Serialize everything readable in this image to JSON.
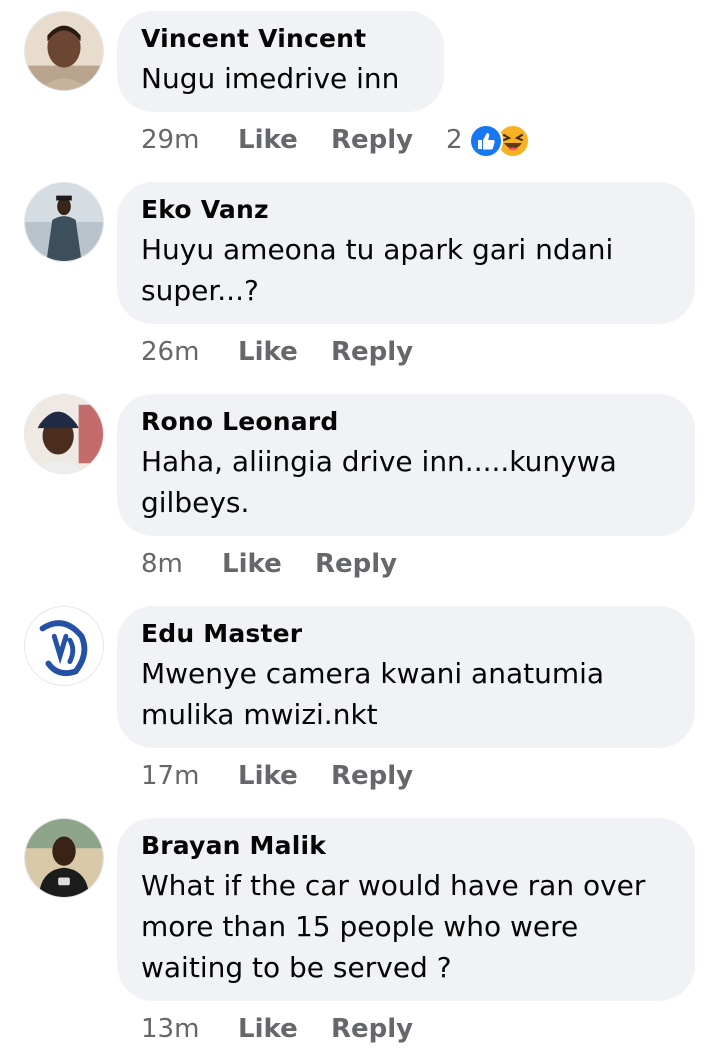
{
  "comments": [
    {
      "author": "Vincent Vincent",
      "lines": [
        "Nugu imedrive inn"
      ],
      "time": "29m",
      "like": "Like",
      "reply": "Reply",
      "reaction_count": "2",
      "reactions": [
        "like-icon",
        "haha-icon"
      ]
    },
    {
      "author": "Eko Vanz",
      "lines": [
        "Huyu ameona tu apark gari ndani",
        "super...?"
      ],
      "time": "26m",
      "like": "Like",
      "reply": "Reply"
    },
    {
      "author": "Rono Leonard",
      "lines": [
        "Haha, aliingia drive inn.....kunywa",
        "gilbeys."
      ],
      "time": "8m",
      "like": "Like",
      "reply": "Reply"
    },
    {
      "author": "Edu Master",
      "lines": [
        "Mwenye camera kwani anatumia",
        "mulika mwizi.nkt"
      ],
      "time": "17m",
      "like": "Like",
      "reply": "Reply"
    },
    {
      "author": "Brayan Malik",
      "lines": [
        "What if the car would have ran over",
        "more than 15 people who were",
        "waiting to be served ?"
      ],
      "time": "13m",
      "like": "Like",
      "reply": "Reply"
    }
  ],
  "colors": {
    "bubble": "#f0f2f5",
    "meta_text": "#65676b",
    "like_blue": "#1877f2",
    "haha_yellow": "#f7b125"
  }
}
